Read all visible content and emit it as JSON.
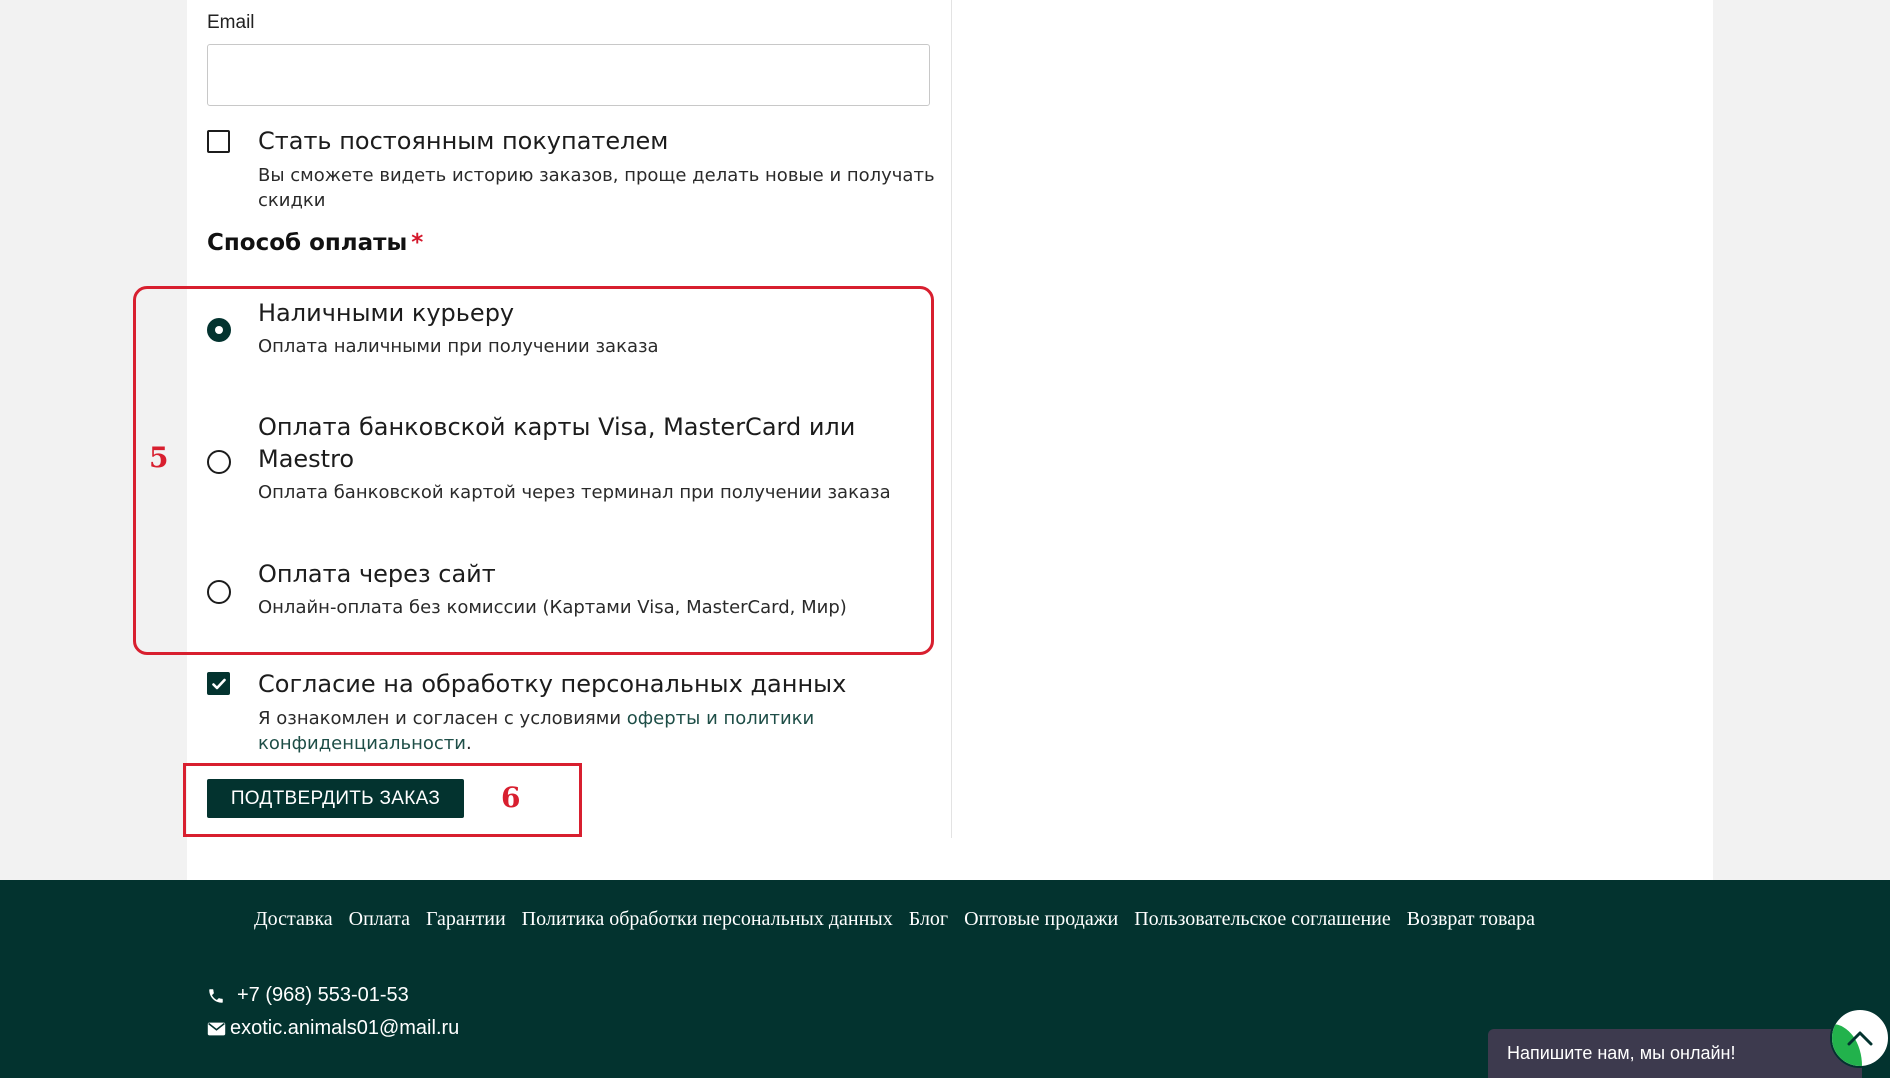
{
  "form": {
    "email_label": "Email",
    "email_value": "",
    "loyal_checkbox": {
      "label": "Стать постоянным покупателем",
      "desc_line1": "Вы сможете видеть историю заказов, проще делать новые и получать",
      "desc_line2": "скидки",
      "checked": false
    },
    "payment_title": "Способ оплаты",
    "payment_required_mark": "*",
    "payment_options": [
      {
        "title": "Наличными курьеру",
        "desc": "Оплата наличными при получении заказа",
        "selected": true
      },
      {
        "title_line1": "Оплата банковской карты Visa, MasterCard или",
        "title_line2": "Maestro",
        "desc": "Оплата банковской картой через терминал при получении заказа",
        "selected": false
      },
      {
        "title": "Оплата через сайт",
        "desc": "Онлайн-оплата без комиссии (Картами Visa, MasterCard, Мир)",
        "selected": false
      }
    ],
    "consent": {
      "label": "Согласие на обработку персональных данных",
      "desc_prefix": "Я ознакомлен и согласен с условиями ",
      "link_offer": "оферты",
      "desc_and": " и ",
      "link_policy_1": "политики",
      "link_policy_2": "конфиденциальности",
      "desc_suffix": ".",
      "checked": true
    },
    "submit_label": "ПОДТВЕРДИТЬ ЗАКАЗ"
  },
  "annotations": {
    "payment_marker": "5",
    "submit_marker": "6",
    "color": "#d81f2f"
  },
  "footer": {
    "nav": [
      "Доставка",
      "Оплата",
      "Гарантии",
      "Политика обработки персональных данных",
      "Блог",
      "Оптовые продажи",
      "Пользовательское соглашение",
      "Возврат товара"
    ],
    "phone": "+7 (968) 553-01-53",
    "email": "exotic.animals01@mail.ru"
  },
  "chat_widget": {
    "label": "Напишите нам, мы онлайн!"
  },
  "colors": {
    "brand": "#03332f",
    "accent_green": "#22b24c",
    "required": "#d4172b"
  }
}
